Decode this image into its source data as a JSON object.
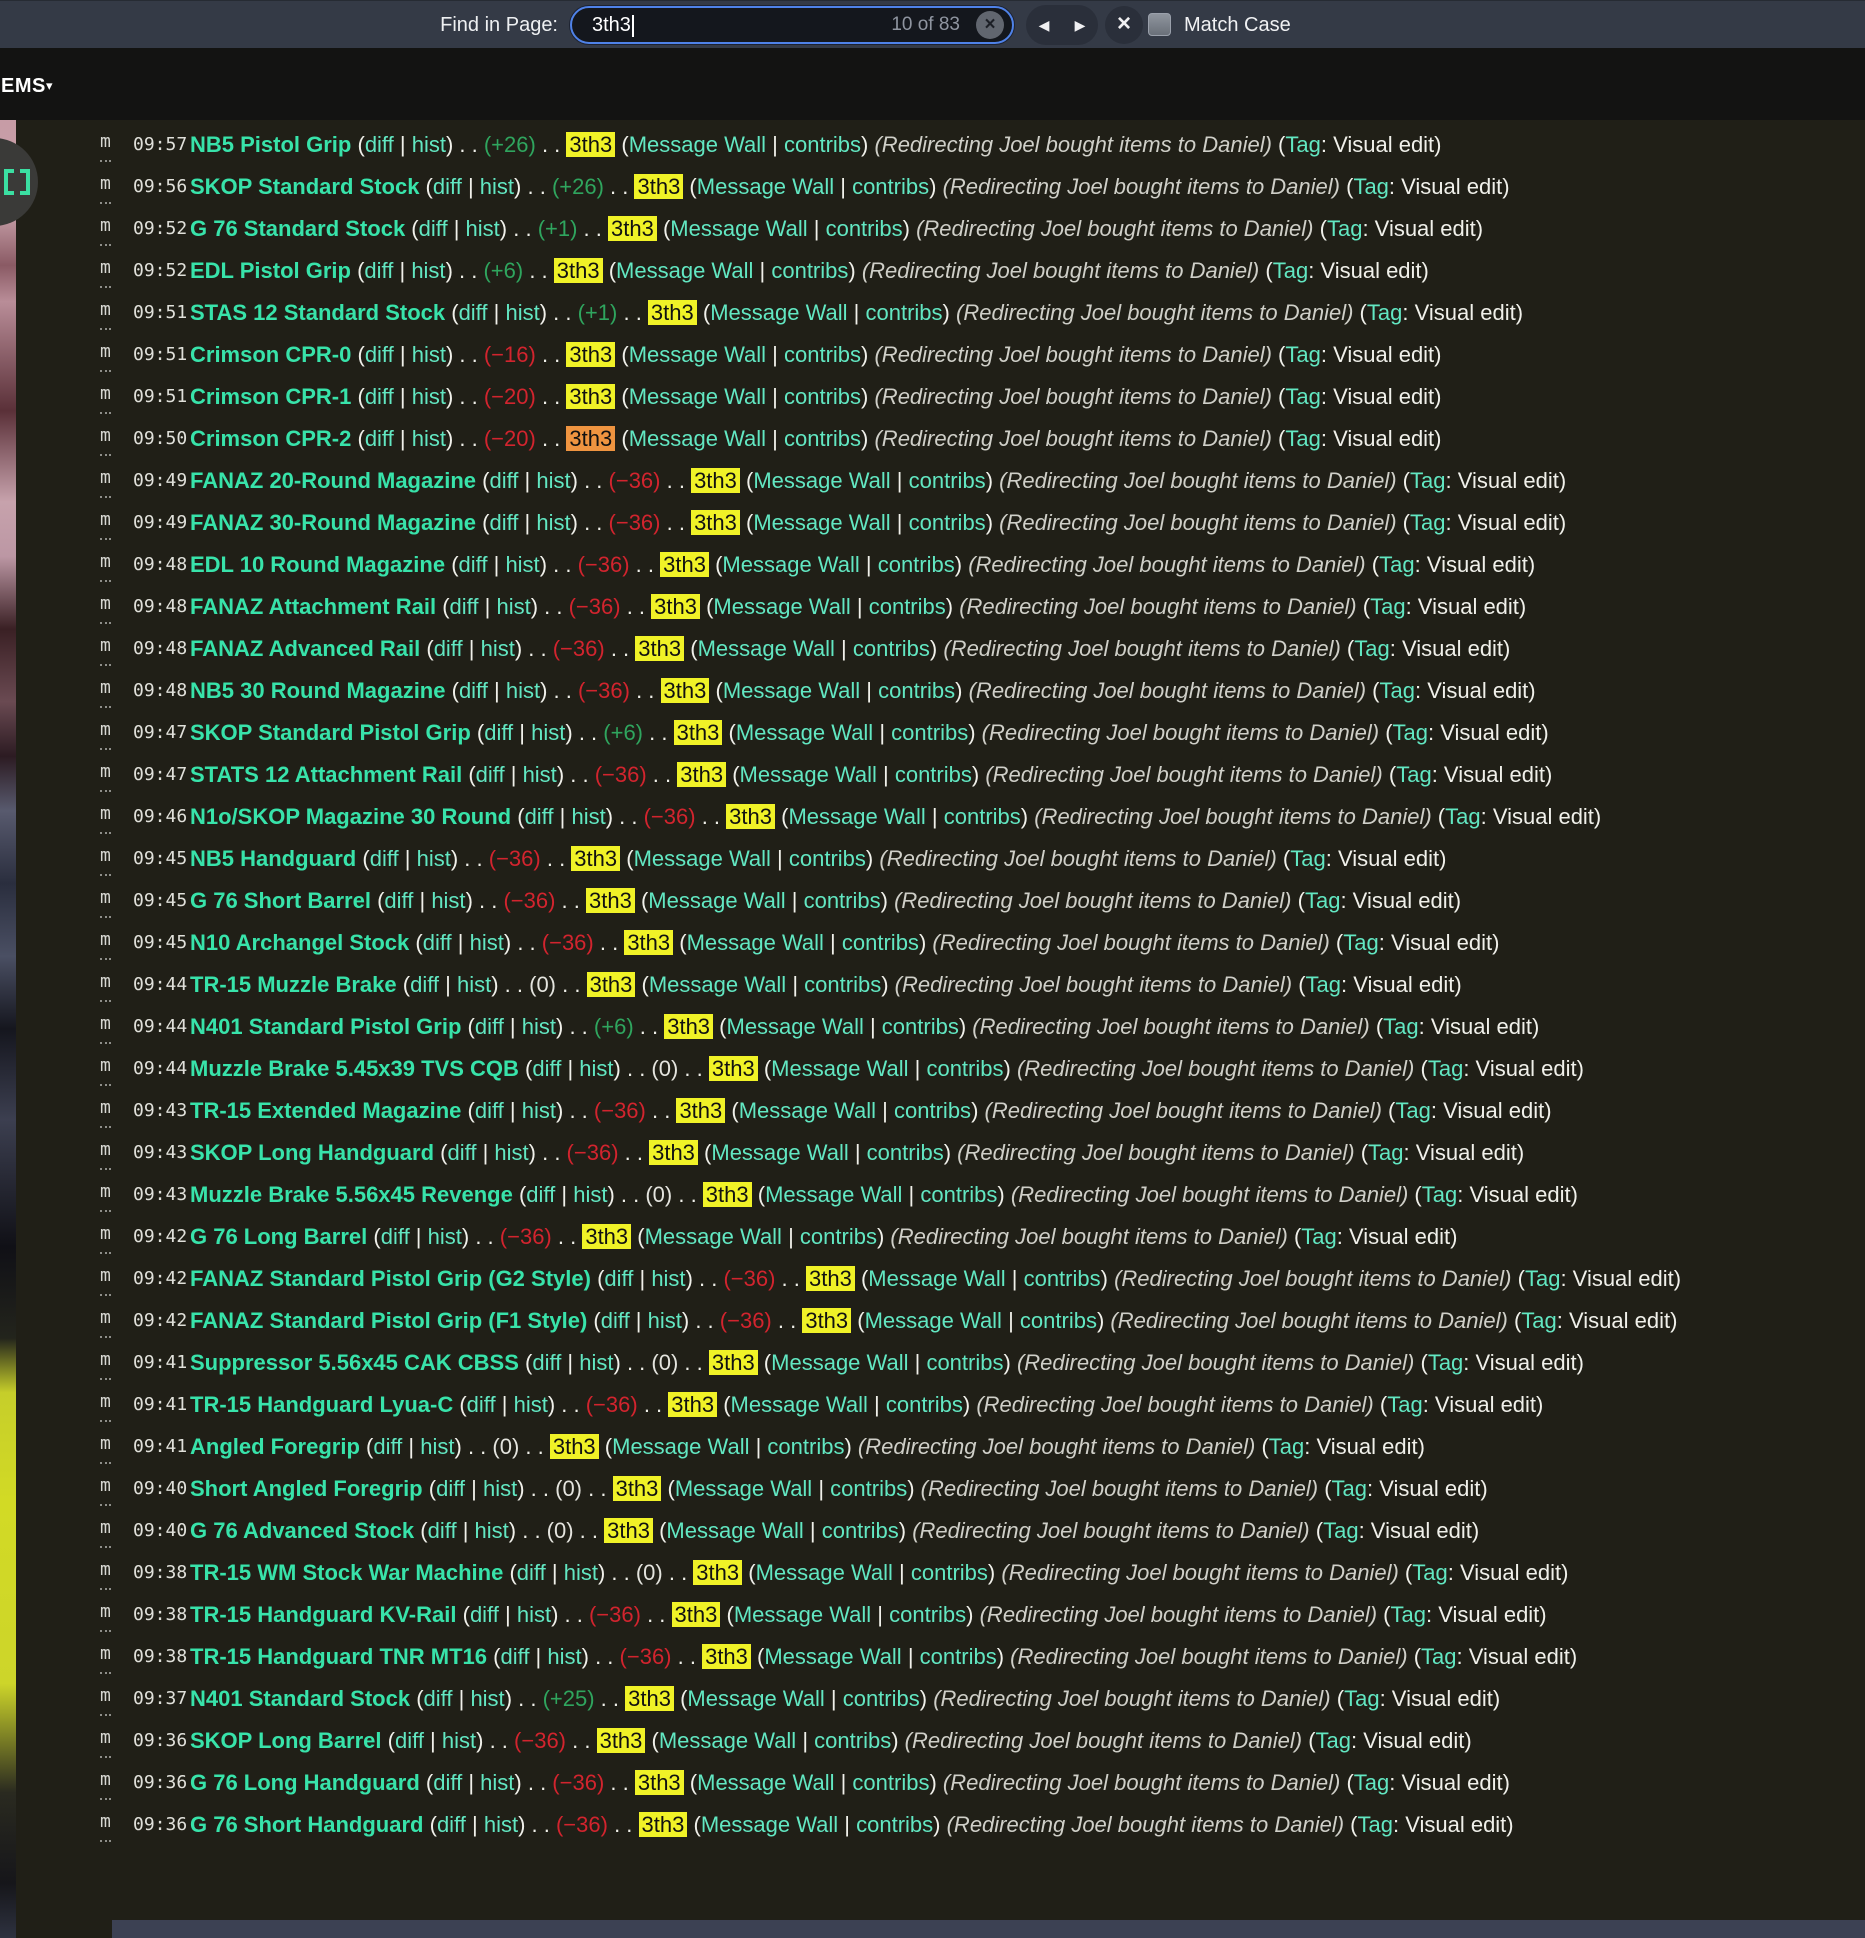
{
  "find_bar": {
    "label": "Find in Page:",
    "query": "3th3",
    "result_count": "10 of 83",
    "clear_icon": "×",
    "prev_icon": "◀",
    "next_icon": "▶",
    "close_icon": "×",
    "match_case_label": "Match Case",
    "accent_color": "#4f82e8"
  },
  "menu": {
    "label": "EMS",
    "caret": "▾"
  },
  "colors": {
    "highlight": "#f0f227",
    "highlight_current": "#ef9440",
    "positive": "#2fa55e",
    "negative": "#d2242e",
    "title_link": "#38e3aa",
    "link": "#62e7c2"
  },
  "list_common": {
    "minor_flag": "m",
    "pre_links": " (",
    "diff_label": "diff",
    "pipe": " | ",
    "hist_label": "hist",
    "post_links": ") . . ",
    "pre_user": " . . ",
    "user": "3th3",
    "post_user_open": " (",
    "message_wall_label": "Message Wall",
    "contribs_label": "contribs",
    "post_contribs": ") ",
    "summary": "(Redirecting Joel bought items to Daniel)",
    "tag_open": " (",
    "tag_label": "Tag",
    "tag_suffix": ": Visual edit)"
  },
  "rows": [
    {
      "time": "09:57",
      "title": "NB5 Pistol Grip",
      "change": "(+26)",
      "change_type": "pos",
      "current": false
    },
    {
      "time": "09:56",
      "title": "SKOP Standard Stock",
      "change": "(+26)",
      "change_type": "pos",
      "current": false
    },
    {
      "time": "09:52",
      "title": "G 76 Standard Stock",
      "change": "(+1)",
      "change_type": "pos",
      "current": false
    },
    {
      "time": "09:52",
      "title": "EDL Pistol Grip",
      "change": "(+6)",
      "change_type": "pos",
      "current": false
    },
    {
      "time": "09:51",
      "title": "STAS 12 Standard Stock",
      "change": "(+1)",
      "change_type": "pos",
      "current": false
    },
    {
      "time": "09:51",
      "title": "Crimson CPR-0",
      "change": "(−16)",
      "change_type": "neg",
      "current": false
    },
    {
      "time": "09:51",
      "title": "Crimson CPR-1",
      "change": "(−20)",
      "change_type": "neg",
      "current": false
    },
    {
      "time": "09:50",
      "title": "Crimson CPR-2",
      "change": "(−20)",
      "change_type": "neg",
      "current": true
    },
    {
      "time": "09:49",
      "title": "FANAZ 20-Round Magazine",
      "change": "(−36)",
      "change_type": "neg",
      "current": false
    },
    {
      "time": "09:49",
      "title": "FANAZ 30-Round Magazine",
      "change": "(−36)",
      "change_type": "neg",
      "current": false
    },
    {
      "time": "09:48",
      "title": "EDL 10 Round Magazine",
      "change": "(−36)",
      "change_type": "neg",
      "current": false
    },
    {
      "time": "09:48",
      "title": "FANAZ Attachment Rail",
      "change": "(−36)",
      "change_type": "neg",
      "current": false
    },
    {
      "time": "09:48",
      "title": "FANAZ Advanced Rail",
      "change": "(−36)",
      "change_type": "neg",
      "current": false
    },
    {
      "time": "09:48",
      "title": "NB5 30 Round Magazine",
      "change": "(−36)",
      "change_type": "neg",
      "current": false
    },
    {
      "time": "09:47",
      "title": "SKOP Standard Pistol Grip",
      "change": "(+6)",
      "change_type": "pos",
      "current": false
    },
    {
      "time": "09:47",
      "title": "STATS 12 Attachment Rail",
      "change": "(−36)",
      "change_type": "neg",
      "current": false
    },
    {
      "time": "09:46",
      "title": "N1o/SKOP Magazine 30 Round",
      "change": "(−36)",
      "change_type": "neg",
      "current": false
    },
    {
      "time": "09:45",
      "title": "NB5 Handguard",
      "change": "(−36)",
      "change_type": "neg",
      "current": false
    },
    {
      "time": "09:45",
      "title": "G 76 Short Barrel",
      "change": "(−36)",
      "change_type": "neg",
      "current": false
    },
    {
      "time": "09:45",
      "title": "N10 Archangel Stock",
      "change": "(−36)",
      "change_type": "neg",
      "current": false
    },
    {
      "time": "09:44",
      "title": "TR-15 Muzzle Brake",
      "change": "(0)",
      "change_type": "zero",
      "current": false
    },
    {
      "time": "09:44",
      "title": "N401 Standard Pistol Grip",
      "change": "(+6)",
      "change_type": "pos",
      "current": false
    },
    {
      "time": "09:44",
      "title": "Muzzle Brake 5.45x39 TVS CQB",
      "change": "(0)",
      "change_type": "zero",
      "current": false
    },
    {
      "time": "09:43",
      "title": "TR-15 Extended Magazine",
      "change": "(−36)",
      "change_type": "neg",
      "current": false
    },
    {
      "time": "09:43",
      "title": "SKOP Long Handguard",
      "change": "(−36)",
      "change_type": "neg",
      "current": false
    },
    {
      "time": "09:43",
      "title": "Muzzle Brake 5.56x45 Revenge",
      "change": "(0)",
      "change_type": "zero",
      "current": false
    },
    {
      "time": "09:42",
      "title": "G 76 Long Barrel",
      "change": "(−36)",
      "change_type": "neg",
      "current": false
    },
    {
      "time": "09:42",
      "title": "FANAZ Standard Pistol Grip (G2 Style)",
      "change": "(−36)",
      "change_type": "neg",
      "current": false
    },
    {
      "time": "09:42",
      "title": "FANAZ Standard Pistol Grip (F1 Style)",
      "change": "(−36)",
      "change_type": "neg",
      "current": false
    },
    {
      "time": "09:41",
      "title": "Suppressor 5.56x45 CAK CBSS",
      "change": "(0)",
      "change_type": "zero",
      "current": false
    },
    {
      "time": "09:41",
      "title": "TR-15 Handguard Lyua-C",
      "change": "(−36)",
      "change_type": "neg",
      "current": false
    },
    {
      "time": "09:41",
      "title": "Angled Foregrip",
      "change": "(0)",
      "change_type": "zero",
      "current": false
    },
    {
      "time": "09:40",
      "title": "Short Angled Foregrip",
      "change": "(0)",
      "change_type": "zero",
      "current": false
    },
    {
      "time": "09:40",
      "title": "G 76 Advanced Stock",
      "change": "(0)",
      "change_type": "zero",
      "current": false
    },
    {
      "time": "09:38",
      "title": "TR-15 WM Stock War Machine",
      "change": "(0)",
      "change_type": "zero",
      "current": false
    },
    {
      "time": "09:38",
      "title": "TR-15 Handguard KV-Rail",
      "change": "(−36)",
      "change_type": "neg",
      "current": false
    },
    {
      "time": "09:38",
      "title": "TR-15 Handguard TNR MT16",
      "change": "(−36)",
      "change_type": "neg",
      "current": false
    },
    {
      "time": "09:37",
      "title": "N401 Standard Stock",
      "change": "(+25)",
      "change_type": "pos",
      "current": false
    },
    {
      "time": "09:36",
      "title": "SKOP Long Barrel",
      "change": "(−36)",
      "change_type": "neg",
      "current": false
    },
    {
      "time": "09:36",
      "title": "G 76 Long Handguard",
      "change": "(−36)",
      "change_type": "neg",
      "current": false
    },
    {
      "time": "09:36",
      "title": "G 76 Short Handguard",
      "change": "(−36)",
      "change_type": "neg",
      "current": false
    }
  ]
}
